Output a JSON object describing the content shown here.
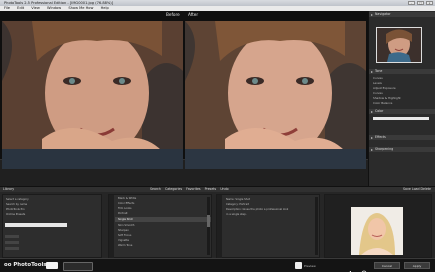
{
  "window": {
    "title": "PhotoTools 2.5 Professional Edition - [IMG0001.jpg (76.88%)]"
  },
  "menu": [
    "File",
    "Edit",
    "View",
    "Window",
    "Show Me How",
    "Help"
  ],
  "viewer": {
    "before_label": "Before",
    "after_label": "After"
  },
  "right_panel": {
    "navigator": "Navigator",
    "tone": "Tone",
    "tone_items": [
      "Curves",
      "Levels",
      "Adjust Exposure",
      "Curves",
      "Shadow & Highlight",
      "Color Balance"
    ],
    "color": "Color",
    "effects": "Effects",
    "sharpening": "Sharpening"
  },
  "bottom": {
    "title": "Library",
    "tabs": [
      "Search",
      "Categories",
      "Favorites",
      "Presets",
      "Undo"
    ],
    "right_tabs": [
      "Save",
      "Load",
      "Delete"
    ],
    "col1_lines": [
      "Select a category",
      "Search by name",
      "PhotoTools Pro",
      "OnOne Presets"
    ],
    "col2_lines": [
      "Black & White",
      "Color Effects",
      "Film Looks",
      "Portrait",
      "Single Shot",
      "Skin Smooth",
      "Sharpen",
      "Soft Focus",
      "Vignette",
      "Warm Tone"
    ],
    "col3_lines": [
      "Name: Single Shot",
      "Category: Portrait",
      "Description: Gives the photo a professional look",
      "in a single step."
    ]
  },
  "status": {
    "brand": "PhotoTools",
    "version": "2.5",
    "preview_label": "Preview",
    "cancel_label": "Cancel",
    "apply_label": "Apply"
  }
}
